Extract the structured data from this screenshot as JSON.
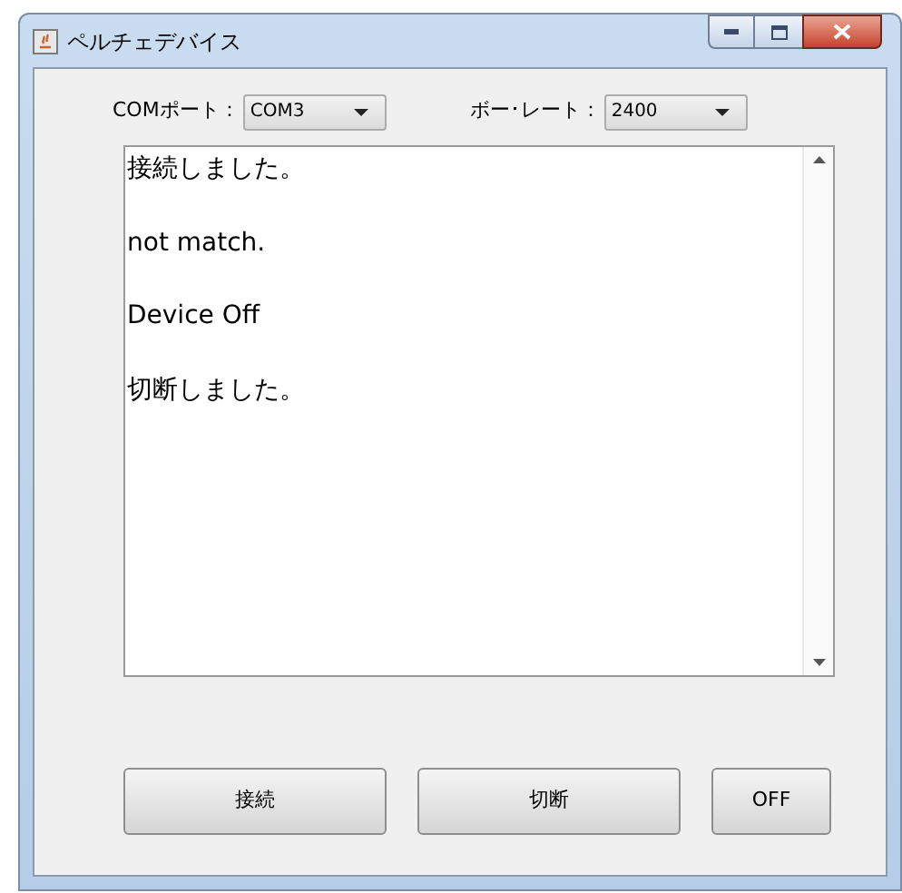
{
  "window": {
    "title": "ペルチェデバイス"
  },
  "settings": [
    {
      "label": "COMポート：",
      "value": "COM3"
    },
    {
      "label": "ボー･レート：",
      "value": "2400"
    }
  ],
  "log": [
    "接続しました。",
    "not match.",
    "Device Off",
    "切断しました。"
  ],
  "buttons": [
    "接続",
    "切断",
    "OFF"
  ]
}
